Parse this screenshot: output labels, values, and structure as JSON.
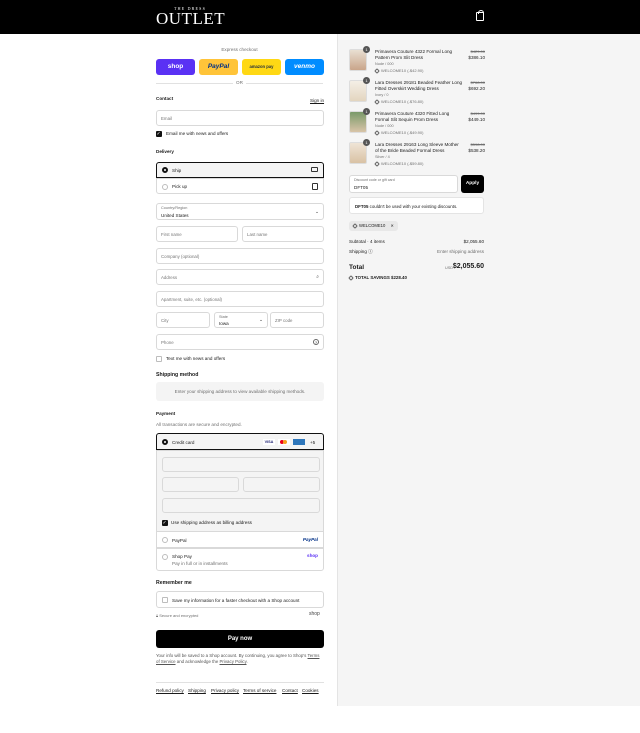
{
  "header": {
    "logo_small": "THE DRESS",
    "logo_big": "OUTLET"
  },
  "express": {
    "title": "Express checkout",
    "or": "OR",
    "buttons": {
      "shop": "shop",
      "paypal": "PayPal",
      "amazon": "amazon pay",
      "venmo": "venmo"
    },
    "colors": {
      "shop": "#5a31f4",
      "paypal": "#ffc439",
      "amazon": "#ffd814",
      "venmo": "#008cff"
    }
  },
  "contact": {
    "heading": "Contact",
    "sign_in": "Sign in",
    "email_placeholder": "Email",
    "email_news": "Email me with news and offers"
  },
  "delivery": {
    "heading": "Delivery",
    "options": [
      "Ship",
      "Pick up"
    ],
    "country_label": "Country/Region",
    "country_value": "United States",
    "first_name": "First name",
    "last_name": "Last name",
    "company": "Company (optional)",
    "address": "Address",
    "apartment": "Apartment, suite, etc. (optional)",
    "city": "City",
    "state_label": "State",
    "state_value": "Iowa",
    "zip": "ZIP code",
    "phone": "Phone",
    "text_news": "Text me with news and offers"
  },
  "shipping": {
    "heading": "Shipping method",
    "info": "Enter your shipping address to view available shipping methods."
  },
  "payment": {
    "heading": "Payment",
    "subtitle": "All transactions are secure and encrypted.",
    "credit_card": "Credit card",
    "card_more": "+5",
    "billing_same": "Use shipping address as billing address",
    "paypal": "PayPal",
    "paypal_logo": "PayPal",
    "shop_pay": "Shop Pay",
    "shop_pay_sub": "Pay in full or in installments",
    "shop_logo": "shop"
  },
  "remember": {
    "heading": "Remember me",
    "save_info": "Save my information for a faster checkout with a Shop account",
    "secure": "Secure and encrypted",
    "shop_logo": "shop"
  },
  "pay_now": "Pay now",
  "legal": {
    "text1": "Your info will be saved to a Shop account. By continuing, you agree to Shop’s",
    "terms": "Terms of Service",
    "text2": "and acknowledge the",
    "privacy": "Privacy Policy",
    "text3": "."
  },
  "footer_links": [
    "Refund policy",
    "Shipping",
    "Privacy policy",
    "Terms of service",
    "Contact",
    "Cookies"
  ],
  "cart": {
    "items": [
      {
        "qty": "1",
        "name_l1": "Primavera Couture 4322 Formal Long",
        "name_l2": "Pattern Prom Slit Dress",
        "variant": "Nude / 000",
        "discount": "WELCOME10 (-$42.90)",
        "was": "$429.00",
        "price": "$386.10"
      },
      {
        "qty": "1",
        "name_l1": "Lara Dresses 29181 Beaded Feather Long",
        "name_l2": "Fitted Overskirt Wedding Dress",
        "variant": "Ivory / 0",
        "discount": "WELCOME10 (-$76.80)",
        "was": "$768.00",
        "price": "$692.20"
      },
      {
        "qty": "1",
        "name_l1": "Primavera Couture 4320 Fitted Long",
        "name_l2": "Formal Slit Sequin Prom Dress",
        "variant": "Nude / 000",
        "discount": "WELCOME10 (-$49.90)",
        "was": "$499.00",
        "price": "$449.10"
      },
      {
        "qty": "1",
        "name_l1": "Lara Dresses 29163 Long Sleeve Mother",
        "name_l2": "of the Bride Beaded Formal Dress",
        "variant": "Silver / 4",
        "discount": "WELCOME10 (-$59.80)",
        "was": "$598.00",
        "price": "$538.20"
      }
    ],
    "discount_label": "Discount code or gift card",
    "discount_value": "DFT05",
    "apply": "Apply",
    "error_code": "DFT05",
    "error_text": "couldn't be used with your existing discounts.",
    "applied_tag": "WELCOME10",
    "subtotal_label": "Subtotal · 4 items",
    "subtotal_value": "$2,055.60",
    "shipping_label": "Shipping",
    "shipping_value": "Enter shipping address",
    "total_label": "Total",
    "currency": "USD",
    "total_value": "$2,055.60",
    "savings_label": "TOTAL SAVINGS",
    "savings_value": "$228.40"
  }
}
